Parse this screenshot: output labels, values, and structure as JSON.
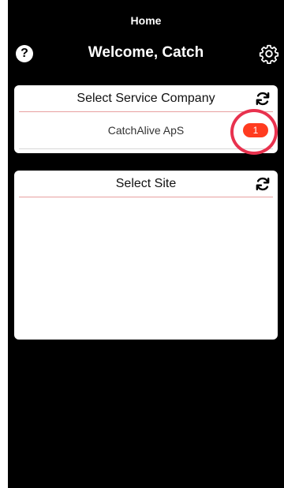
{
  "nav": {
    "title": "Home"
  },
  "header": {
    "welcome": "Welcome, Catch",
    "help_icon": "?"
  },
  "service_company": {
    "title": "Select Service Company",
    "items": [
      {
        "label": "CatchAlive ApS",
        "badge": "1"
      }
    ]
  },
  "site": {
    "title": "Select Site",
    "items": []
  },
  "colors": {
    "background": "#000000",
    "card": "#ffffff",
    "divider": "#e8a0a0",
    "badge": "#ff3b1f",
    "highlight": "#e8324e"
  },
  "icons": [
    "help-icon",
    "gear-icon",
    "refresh-icon"
  ]
}
